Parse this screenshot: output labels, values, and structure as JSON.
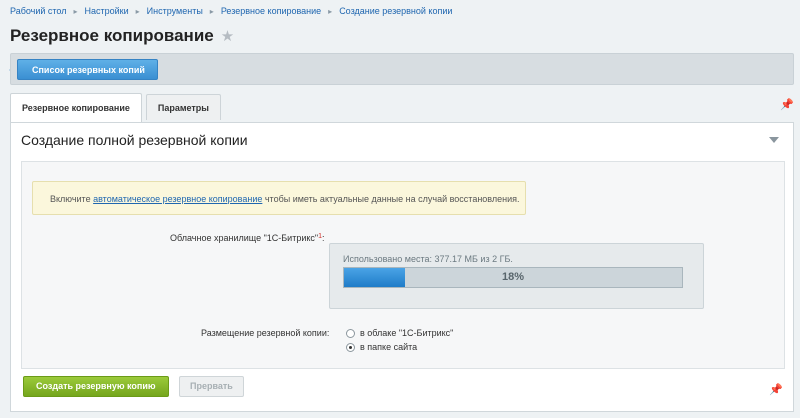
{
  "breadcrumb": [
    "Рабочий стол",
    "Настройки",
    "Инструменты",
    "Резервное копирование",
    "Создание резервной копии"
  ],
  "breadcrumb_separator": "▸",
  "page": {
    "title": "Резервное копирование",
    "star_icon": "star-icon"
  },
  "toolbar": {
    "list_button": "Список резервных копий"
  },
  "tabs": [
    "Резервное копирование",
    "Параметры"
  ],
  "section": {
    "title": "Создание полной резервной копии",
    "notice": {
      "before": "Включите ",
      "link": "автоматическое резервное копирование",
      "after": " чтобы иметь актуальные данные на случай восстановления."
    },
    "cloud_label": "Облачное хранилище \"1С-Битрикс\"",
    "cloud_marker": "1",
    "cloud_label_colon": ":",
    "usage_text": "Использовано места: 377.17 МБ из 2 ГБ.",
    "progress": {
      "percent": 18,
      "label": "18%"
    },
    "placement_label": "Размещение резервной копии:",
    "placement_options": [
      {
        "label": "в облаке \"1С-Битрикс\"",
        "selected": false
      },
      {
        "label": "в папке сайта",
        "selected": true
      }
    ]
  },
  "actions": {
    "create": "Создать резервную копию",
    "abort": "Прервать"
  },
  "colors": {
    "accent_blue": "#3a8fd2",
    "green": "#75a61d",
    "notice_bg": "#fbf7dc"
  }
}
